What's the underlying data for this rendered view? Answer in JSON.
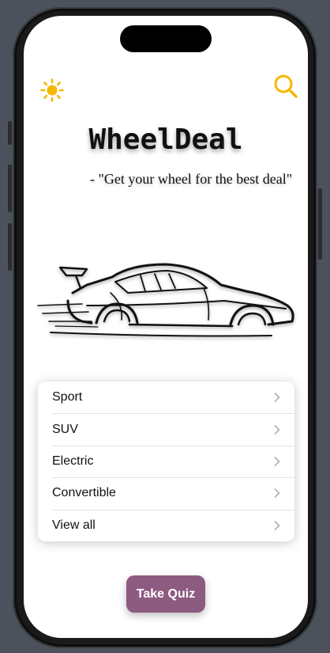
{
  "header": {
    "theme_toggle_icon": "sun-icon",
    "search_icon": "magnifying-glass-icon",
    "accent_color": "#F5B800"
  },
  "hero": {
    "title": "WheelDeal",
    "tagline": "- \"Get your wheel for the best deal\"",
    "illustration": "sports-car-sketch"
  },
  "categories": {
    "items": [
      {
        "label": "Sport"
      },
      {
        "label": "SUV"
      },
      {
        "label": "Electric"
      },
      {
        "label": "Convertible"
      },
      {
        "label": "View all"
      }
    ]
  },
  "actions": {
    "quiz_label": "Take Quiz",
    "quiz_color": "#8D5A80"
  }
}
